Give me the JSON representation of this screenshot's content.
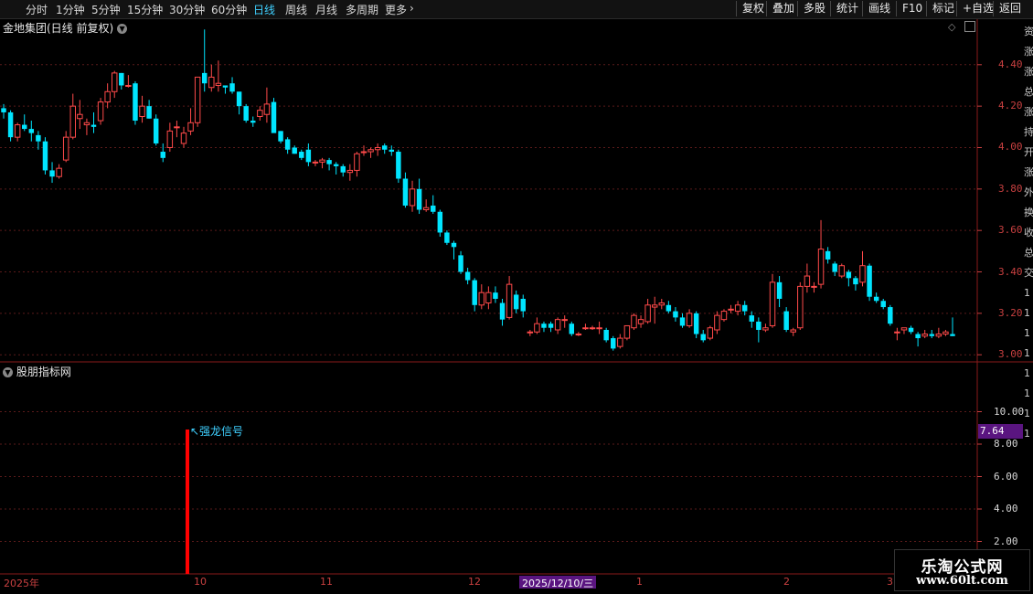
{
  "period_tabs": [
    {
      "label": "分时",
      "active": false
    },
    {
      "label": "1分钟",
      "active": false
    },
    {
      "label": "5分钟",
      "active": false
    },
    {
      "label": "15分钟",
      "active": false
    },
    {
      "label": "30分钟",
      "active": false
    },
    {
      "label": "60分钟",
      "active": false
    },
    {
      "label": "日线",
      "active": true
    },
    {
      "label": "周线",
      "active": false
    },
    {
      "label": "月线",
      "active": false
    },
    {
      "label": "多周期",
      "active": false
    },
    {
      "label": "更多",
      "active": false
    }
  ],
  "right_buttons": [
    "复权",
    "叠加",
    "多股",
    "统计",
    "画线",
    "F10",
    "标记",
    "+自选",
    "返回"
  ],
  "chart_title": "金地集团(日线 前复权)",
  "indicator_title": "股朋指标网",
  "signal_label": "↖强龙信号",
  "indicator_value": "7.64",
  "price_axis": [
    "4.40",
    "4.20",
    "4.00",
    "3.80",
    "3.60",
    "3.40",
    "3.20",
    "3.00"
  ],
  "indicator_axis": [
    "10.00",
    "8.00",
    "6.00",
    "4.00",
    "2.00"
  ],
  "date_labels": [
    "2025年",
    "10",
    "11",
    "12",
    "1",
    "2",
    "3"
  ],
  "cursor_date": "2025/12/10/三",
  "watermark": {
    "line1": "乐淘公式网",
    "line2": "www.60lt.com"
  },
  "side_chars": [
    "资",
    "涨",
    "涨",
    "总",
    "涨",
    "持",
    "开",
    "涨",
    "外",
    "换",
    "收",
    "总",
    "交",
    "1",
    "1",
    "1",
    "1",
    "1",
    "1",
    "1",
    "1"
  ],
  "colors": {
    "up": "#ff4a4a",
    "down": "#00e5ff",
    "axis": "#c84040",
    "signal": "#ff0000",
    "value_bg": "#5a1580"
  },
  "chart_data": {
    "type": "candlestick",
    "title": "金地集团(日线 前复权)",
    "ylim": [
      2.97,
      4.58
    ],
    "yticks": [
      3.0,
      3.2,
      3.4,
      3.6,
      3.8,
      4.0,
      4.2,
      4.4
    ],
    "months": [
      "2025年",
      "10",
      "11",
      "12",
      "1",
      "2",
      "3"
    ],
    "candles": [
      [
        4.19,
        4.21,
        4.14,
        4.17
      ],
      [
        4.17,
        4.18,
        4.03,
        4.05
      ],
      [
        4.05,
        4.12,
        4.03,
        4.11
      ],
      [
        4.11,
        4.16,
        4.08,
        4.09
      ],
      [
        4.09,
        4.13,
        4.03,
        4.07
      ],
      [
        4.06,
        4.08,
        3.99,
        4.03
      ],
      [
        4.03,
        4.05,
        3.87,
        3.89
      ],
      [
        3.89,
        3.93,
        3.83,
        3.86
      ],
      [
        3.86,
        3.92,
        3.85,
        3.9
      ],
      [
        3.94,
        4.08,
        3.93,
        4.05
      ],
      [
        4.05,
        4.26,
        4.04,
        4.2
      ],
      [
        4.14,
        4.23,
        4.09,
        4.16
      ],
      [
        4.11,
        4.14,
        4.06,
        4.12
      ],
      [
        4.11,
        4.17,
        4.07,
        4.1
      ],
      [
        4.13,
        4.24,
        4.11,
        4.22
      ],
      [
        4.22,
        4.31,
        4.19,
        4.27
      ],
      [
        4.27,
        4.37,
        4.24,
        4.36
      ],
      [
        4.36,
        4.36,
        4.28,
        4.3
      ],
      [
        4.3,
        4.35,
        4.29,
        4.3
      ],
      [
        4.31,
        4.32,
        4.11,
        4.13
      ],
      [
        4.15,
        4.25,
        4.12,
        4.2
      ],
      [
        4.2,
        4.23,
        4.14,
        4.14
      ],
      [
        4.14,
        4.16,
        4.01,
        4.02
      ],
      [
        3.98,
        4.02,
        3.93,
        3.95
      ],
      [
        4.0,
        4.12,
        3.98,
        4.08
      ],
      [
        4.1,
        4.13,
        4.05,
        4.1
      ],
      [
        4.02,
        4.1,
        4.0,
        4.07
      ],
      [
        4.08,
        4.19,
        4.06,
        4.12
      ],
      [
        4.12,
        4.31,
        4.1,
        4.34
      ],
      [
        4.36,
        4.57,
        4.27,
        4.31
      ],
      [
        4.29,
        4.4,
        4.27,
        4.34
      ],
      [
        4.3,
        4.42,
        4.27,
        4.31
      ],
      [
        4.3,
        4.3,
        4.26,
        4.29
      ],
      [
        4.31,
        4.34,
        4.26,
        4.27
      ],
      [
        4.27,
        4.27,
        4.16,
        4.2
      ],
      [
        4.2,
        4.21,
        4.12,
        4.13
      ],
      [
        4.13,
        4.15,
        4.1,
        4.12
      ],
      [
        4.15,
        4.2,
        4.13,
        4.18
      ],
      [
        4.16,
        4.29,
        4.12,
        4.21
      ],
      [
        4.22,
        4.24,
        4.08,
        4.07
      ],
      [
        4.08,
        4.08,
        4.02,
        4.03
      ],
      [
        4.04,
        4.05,
        3.97,
        3.99
      ],
      [
        4.0,
        4.01,
        3.97,
        3.97
      ],
      [
        3.98,
        3.99,
        3.94,
        3.95
      ],
      [
        3.99,
        4.02,
        3.91,
        3.93
      ],
      [
        3.93,
        3.94,
        3.91,
        3.93
      ],
      [
        3.93,
        3.95,
        3.9,
        3.94
      ],
      [
        3.94,
        3.95,
        3.89,
        3.92
      ],
      [
        3.92,
        3.93,
        3.87,
        3.91
      ],
      [
        3.91,
        3.92,
        3.86,
        3.88
      ],
      [
        3.88,
        3.92,
        3.84,
        3.89
      ],
      [
        3.89,
        3.98,
        3.86,
        3.97
      ],
      [
        3.98,
        4.01,
        3.96,
        3.98
      ],
      [
        3.98,
        4.0,
        3.95,
        3.99
      ],
      [
        3.99,
        4.02,
        3.96,
        4.0
      ],
      [
        4.01,
        4.02,
        3.97,
        3.99
      ],
      [
        3.99,
        4.01,
        3.96,
        3.98
      ],
      [
        3.98,
        3.99,
        3.83,
        3.85
      ],
      [
        3.85,
        3.88,
        3.71,
        3.72
      ],
      [
        3.72,
        3.84,
        3.69,
        3.8
      ],
      [
        3.8,
        3.85,
        3.68,
        3.7
      ],
      [
        3.7,
        3.75,
        3.69,
        3.71
      ],
      [
        3.72,
        3.77,
        3.68,
        3.69
      ],
      [
        3.69,
        3.7,
        3.57,
        3.59
      ],
      [
        3.59,
        3.6,
        3.53,
        3.54
      ],
      [
        3.54,
        3.55,
        3.46,
        3.52
      ],
      [
        3.48,
        3.5,
        3.39,
        3.4
      ],
      [
        3.4,
        3.42,
        3.34,
        3.36
      ],
      [
        3.36,
        3.37,
        3.21,
        3.24
      ],
      [
        3.24,
        3.34,
        3.22,
        3.3
      ],
      [
        3.25,
        3.33,
        3.22,
        3.3
      ],
      [
        3.3,
        3.33,
        3.25,
        3.27
      ],
      [
        3.25,
        3.27,
        3.14,
        3.17
      ],
      [
        3.18,
        3.38,
        3.17,
        3.34
      ],
      [
        3.29,
        3.31,
        3.2,
        3.22
      ],
      [
        3.27,
        3.29,
        3.18,
        3.21
      ],
      [
        3.11,
        3.12,
        3.09,
        3.11
      ],
      [
        3.11,
        3.18,
        3.1,
        3.15
      ],
      [
        3.15,
        3.16,
        3.11,
        3.13
      ],
      [
        3.15,
        3.16,
        3.11,
        3.13
      ],
      [
        3.12,
        3.18,
        3.1,
        3.17
      ],
      [
        3.17,
        3.19,
        3.13,
        3.17
      ],
      [
        3.15,
        3.16,
        3.09,
        3.1
      ],
      [
        3.1,
        3.11,
        3.09,
        3.1
      ],
      [
        3.13,
        3.15,
        3.12,
        3.13
      ],
      [
        3.13,
        3.14,
        3.12,
        3.13
      ],
      [
        3.13,
        3.16,
        3.1,
        3.13
      ],
      [
        3.12,
        3.13,
        3.06,
        3.07
      ],
      [
        3.08,
        3.09,
        3.02,
        3.03
      ],
      [
        3.04,
        3.1,
        3.03,
        3.08
      ],
      [
        3.08,
        3.13,
        3.07,
        3.14
      ],
      [
        3.13,
        3.2,
        3.12,
        3.19
      ],
      [
        3.15,
        3.19,
        3.13,
        3.17
      ],
      [
        3.16,
        3.27,
        3.15,
        3.24
      ],
      [
        3.23,
        3.28,
        3.15,
        3.24
      ],
      [
        3.24,
        3.27,
        3.22,
        3.25
      ],
      [
        3.24,
        3.26,
        3.2,
        3.21
      ],
      [
        3.21,
        3.23,
        3.16,
        3.18
      ],
      [
        3.18,
        3.2,
        3.13,
        3.14
      ],
      [
        3.14,
        3.22,
        3.13,
        3.2
      ],
      [
        3.2,
        3.21,
        3.08,
        3.1
      ],
      [
        3.1,
        3.12,
        3.06,
        3.07
      ],
      [
        3.08,
        3.14,
        3.07,
        3.13
      ],
      [
        3.12,
        3.21,
        3.1,
        3.19
      ],
      [
        3.17,
        3.22,
        3.16,
        3.21
      ],
      [
        3.22,
        3.24,
        3.2,
        3.22
      ],
      [
        3.21,
        3.26,
        3.19,
        3.24
      ],
      [
        3.24,
        3.26,
        3.19,
        3.21
      ],
      [
        3.19,
        3.21,
        3.13,
        3.16
      ],
      [
        3.16,
        3.18,
        3.06,
        3.12
      ],
      [
        3.12,
        3.15,
        3.11,
        3.13
      ],
      [
        3.14,
        3.39,
        3.13,
        3.35
      ],
      [
        3.35,
        3.38,
        3.23,
        3.27
      ],
      [
        3.21,
        3.23,
        3.11,
        3.12
      ],
      [
        3.11,
        3.13,
        3.09,
        3.12
      ],
      [
        3.13,
        3.35,
        3.12,
        3.33
      ],
      [
        3.33,
        3.44,
        3.3,
        3.38
      ],
      [
        3.33,
        3.35,
        3.3,
        3.33
      ],
      [
        3.34,
        3.65,
        3.32,
        3.51
      ],
      [
        3.5,
        3.52,
        3.44,
        3.46
      ],
      [
        3.44,
        3.45,
        3.38,
        3.4
      ],
      [
        3.38,
        3.44,
        3.37,
        3.43
      ],
      [
        3.4,
        3.41,
        3.33,
        3.37
      ],
      [
        3.37,
        3.38,
        3.31,
        3.34
      ],
      [
        3.35,
        3.5,
        3.33,
        3.43
      ],
      [
        3.43,
        3.44,
        3.26,
        3.28
      ],
      [
        3.28,
        3.3,
        3.25,
        3.26
      ],
      [
        3.26,
        3.27,
        3.22,
        3.23
      ],
      [
        3.23,
        3.24,
        3.14,
        3.15
      ],
      [
        3.11,
        3.13,
        3.07,
        3.11
      ],
      [
        3.12,
        3.13,
        3.1,
        3.13
      ],
      [
        3.13,
        3.14,
        3.1,
        3.11
      ],
      [
        3.1,
        3.11,
        3.04,
        3.08
      ],
      [
        3.09,
        3.12,
        3.08,
        3.1
      ],
      [
        3.1,
        3.12,
        3.08,
        3.09
      ],
      [
        3.09,
        3.13,
        3.08,
        3.1
      ],
      [
        3.1,
        3.12,
        3.09,
        3.11
      ],
      [
        3.1,
        3.18,
        3.09,
        3.09
      ]
    ],
    "indicator": {
      "name": "股朋指标网",
      "ylim": [
        0,
        12
      ],
      "yticks": [
        2,
        4,
        6,
        8,
        10
      ],
      "current_value": 7.64,
      "signal_bar": {
        "candle_index": 48,
        "value": 8.9,
        "label": "↖强龙信号"
      }
    }
  }
}
